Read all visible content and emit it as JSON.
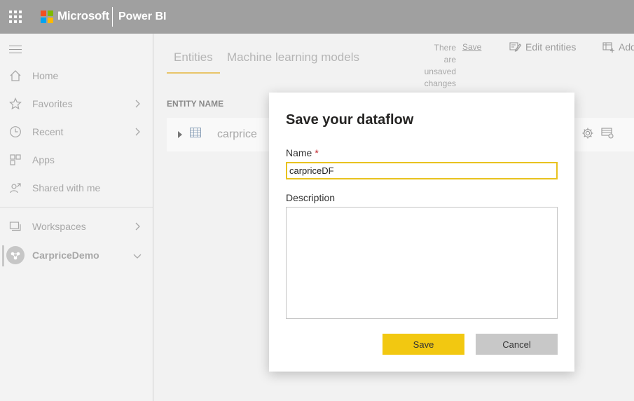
{
  "header": {
    "brand": "Microsoft",
    "product": "Power BI",
    "icons": [
      "app-launcher-icon",
      "microsoft-logo"
    ],
    "brand_colors": [
      "#f25022",
      "#7fba00",
      "#00a4ef",
      "#ffb900"
    ]
  },
  "sidebar": {
    "items": [
      {
        "label": "Home",
        "icon": "home-icon"
      },
      {
        "label": "Favorites",
        "icon": "star-icon"
      },
      {
        "label": "Recent",
        "icon": "clock-icon"
      },
      {
        "label": "Apps",
        "icon": "apps-icon"
      },
      {
        "label": "Shared with me",
        "icon": "shared-icon"
      },
      {
        "label": "Workspaces",
        "icon": "workspaces-icon"
      }
    ],
    "active_workspace": {
      "label": "CarpriceDemo",
      "icon": "workspace-avatar"
    }
  },
  "main": {
    "tabs": [
      {
        "label": "Entities",
        "active": true
      },
      {
        "label": "Machine learning models",
        "active": false
      }
    ],
    "unsaved_lines": [
      "There",
      "are",
      "unsaved",
      "changes"
    ],
    "save_link": "Save",
    "edit_entities": "Edit entities",
    "add_entities": "Add",
    "column_header": "ENTITY NAME",
    "entities": [
      {
        "name": "carprice"
      }
    ]
  },
  "dialog": {
    "title": "Save your dataflow",
    "name_label": "Name",
    "required_marker": "*",
    "name_value": "carpriceDF",
    "description_label": "Description",
    "description_value": "",
    "save_label": "Save",
    "cancel_label": "Cancel",
    "accent_color": "#f2c811"
  }
}
